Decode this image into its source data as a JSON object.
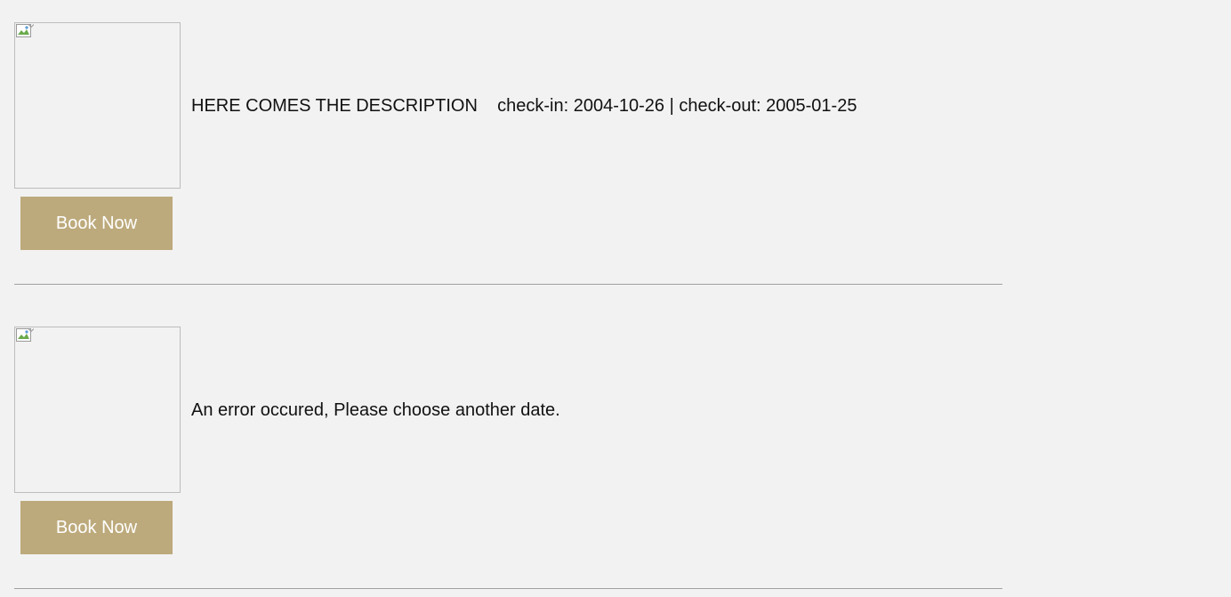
{
  "listings": [
    {
      "image_icon": "broken-image-icon",
      "description": "HERE COMES THE DESCRIPTION    check-in: 2004-10-26 | check-out: 2005-01-25",
      "button_label": "Book Now"
    },
    {
      "image_icon": "broken-image-icon",
      "description": "An error occured, Please choose another date.",
      "button_label": "Book Now"
    }
  ],
  "colors": {
    "background": "#f2f2f2",
    "button_bg": "#bdaa7c",
    "button_text": "#ffffff",
    "divider": "#a0a0a0"
  }
}
